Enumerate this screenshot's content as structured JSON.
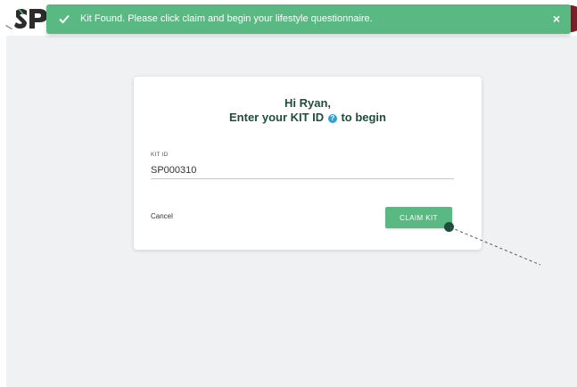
{
  "toast": {
    "message": "Kit Found. Please click claim and begin your lifestyle questionnaire.",
    "close_label": "×",
    "icon": "check-icon",
    "color": "#5ab883"
  },
  "header": {
    "logo": "sp-logo",
    "avatar_icon": "user-avatar"
  },
  "card": {
    "greeting": "Hi Ryan,",
    "title_before": "Enter your KIT ID",
    "title_after": "to begin",
    "help_icon": "question-icon",
    "field_label": "KIT ID",
    "field_value": "SP000310",
    "cancel_label": "Cancel",
    "claim_label": "CLAIM KIT"
  },
  "colors": {
    "brand_green": "#5ab883",
    "title_green": "#1e4d3b",
    "help_blue": "#2f9fd8",
    "background": "#f0f1f3"
  }
}
